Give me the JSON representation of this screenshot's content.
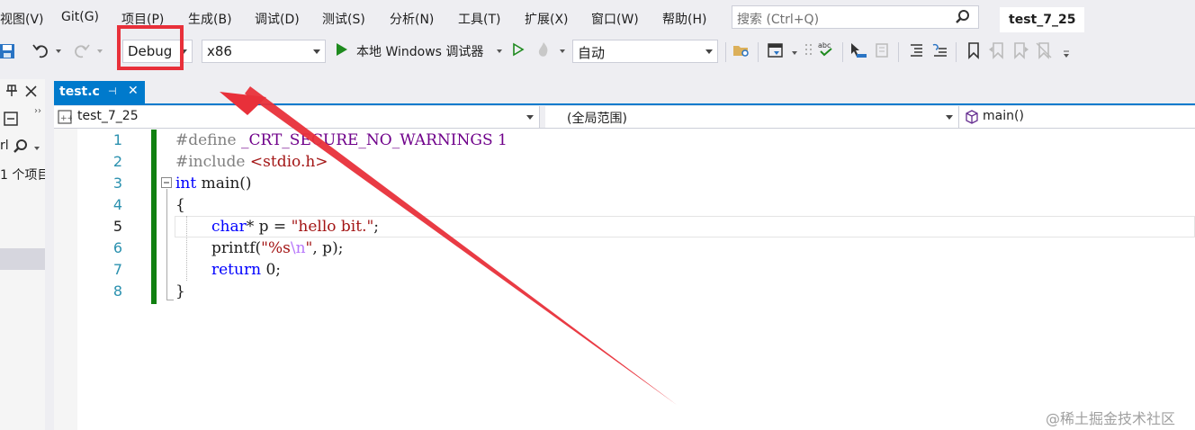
{
  "menu": [
    "视图(V)",
    "Git(G)",
    "项目(P)",
    "生成(B)",
    "调试(D)",
    "测试(S)",
    "分析(N)",
    "工具(T)",
    "扩展(X)",
    "窗口(W)",
    "帮助(H)"
  ],
  "search": {
    "placeholder": "搜索 (Ctrl+Q)"
  },
  "project_title": "test_7_25",
  "toolbar": {
    "configuration": "Debug",
    "platform": "x86",
    "debugger_label": "本地 Windows 调试器",
    "auto_label": "自动"
  },
  "left_panel": {
    "search_prefix": "rl",
    "project_count": "1 个项目"
  },
  "tab": {
    "label": "test.c",
    "pin": "⊣",
    "close": "✕"
  },
  "navbar": {
    "project": "test_7_25",
    "scope": "(全局范围)",
    "member": "main()"
  },
  "code": {
    "line_numbers": [
      "1",
      "2",
      "3",
      "4",
      "5",
      "6",
      "7",
      "8"
    ],
    "l1_directive": "#define",
    "l1_rest": " _CRT_SECURE_NO_WARNINGS 1",
    "l2_directive": "#include",
    "l2_rest": " <stdio.h>",
    "l3_kw": "int",
    "l3_rest": " main()",
    "l4": "{",
    "l5_kw": "char",
    "l5_mid": "* p = ",
    "l5_str": "\"hello bit.\"",
    "l5_end": ";",
    "l6_a": "printf(",
    "l6_str": "\"%s",
    "l6_esc": "\\n",
    "l6_str2": "\"",
    "l6_end": ", p);",
    "l7_kw": "return",
    "l7_rest": " 0;",
    "l8": "}"
  },
  "watermark": "@稀土掘金技术社区",
  "colors": {
    "accent": "#007acc",
    "highlight": "#e8303a",
    "keyword": "#0000ff",
    "string": "#a31515",
    "macro": "#6f008a",
    "change_bar": "#108010"
  }
}
